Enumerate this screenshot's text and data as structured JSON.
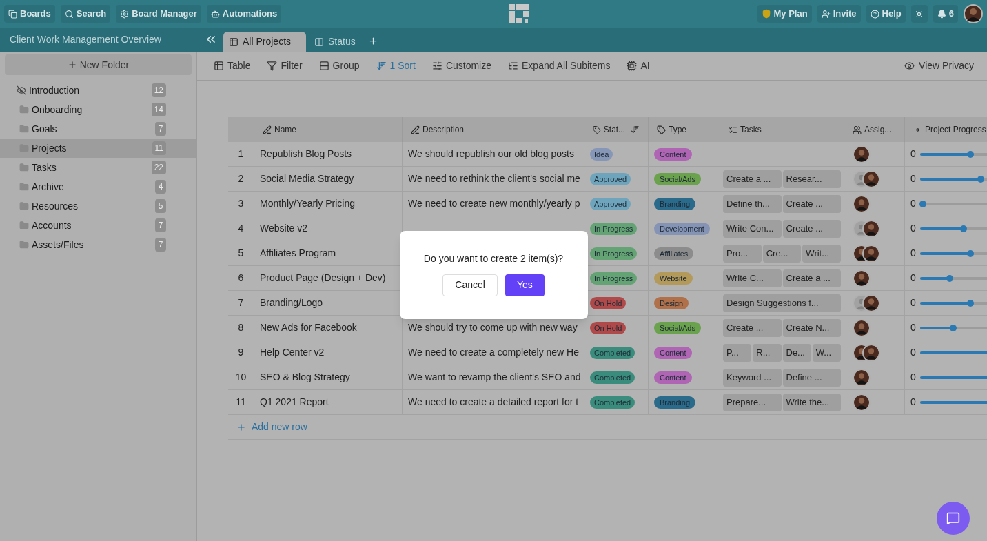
{
  "top_bar": {
    "left_buttons": [
      "Boards",
      "Search",
      "Board Manager",
      "Automations"
    ],
    "plan": "My Plan",
    "invite": "Invite",
    "help": "Help",
    "notifications": "6"
  },
  "workspace_title": "Client Work Management Overview",
  "tabs": [
    {
      "label": "All Projects",
      "kind": "table",
      "selected": true
    },
    {
      "label": "Status",
      "kind": "board",
      "selected": false
    }
  ],
  "toolbar": [
    {
      "label": "Table",
      "active": false
    },
    {
      "label": "Filter",
      "active": false
    },
    {
      "label": "Group",
      "active": false
    },
    {
      "label": "1 Sort",
      "active": true
    },
    {
      "label": "Customize",
      "active": false
    },
    {
      "label": "Expand All Subitems",
      "active": false
    },
    {
      "label": "AI",
      "active": false
    }
  ],
  "view_privacy": "View Privacy",
  "sidebar": {
    "new_folder": "New Folder",
    "items": [
      {
        "name": "Introduction",
        "count": "12",
        "kind": "hidden",
        "selected": false
      },
      {
        "name": "Onboarding",
        "count": "14",
        "kind": "folder",
        "selected": false
      },
      {
        "name": "Goals",
        "count": "7",
        "kind": "folder",
        "selected": false
      },
      {
        "name": "Projects",
        "count": "11",
        "kind": "folder",
        "selected": true
      },
      {
        "name": "Tasks",
        "count": "22",
        "kind": "folder",
        "selected": false
      },
      {
        "name": "Archive",
        "count": "4",
        "kind": "folder",
        "selected": false
      },
      {
        "name": "Resources",
        "count": "5",
        "kind": "folder",
        "selected": false
      },
      {
        "name": "Accounts",
        "count": "7",
        "kind": "folder",
        "selected": false
      },
      {
        "name": "Assets/Files",
        "count": "7",
        "kind": "folder",
        "selected": false
      }
    ]
  },
  "table": {
    "columns": [
      "Name",
      "Description",
      "Stat...",
      "Type",
      "Tasks",
      "Assig...",
      "Project Progress"
    ],
    "rows": [
      {
        "index": "1",
        "name": "Republish Blog Posts",
        "description": "We should republish our old blog posts",
        "status": {
          "label": "Idea",
          "color": "#8696b7"
        },
        "type": {
          "label": "Content",
          "color": "#b064b4"
        },
        "tasks": [],
        "assignees": [
          {
            "kind": "photo"
          }
        ],
        "progress": "0",
        "level": 0.58
      },
      {
        "index": "2",
        "name": "Social Media Strategy",
        "description": "We need to rethink the client's social me",
        "status": {
          "label": "Approved",
          "color": "#6ea5bc"
        },
        "type": {
          "label": "Social/Ads",
          "color": "#6ba24d"
        },
        "tasks": [
          "Create a ...",
          "Resear..."
        ],
        "assignees": [
          {
            "kind": "placeholder"
          },
          {
            "kind": "photo"
          }
        ],
        "progress": "0",
        "level": 0.7
      },
      {
        "index": "3",
        "name": "Monthly/Yearly Pricing",
        "description": "We need to create new monthly/yearly p",
        "status": {
          "label": "Approved",
          "color": "#6ea5bc"
        },
        "type": {
          "label": "Branding",
          "color": "#2a6a8a"
        },
        "tasks": [
          "Define th...",
          "Create ..."
        ],
        "assignees": [
          {
            "kind": "photo"
          }
        ],
        "progress": "0",
        "level": 0.03
      },
      {
        "index": "4",
        "name": "Website v2",
        "status": {
          "label": "In Progress",
          "color": "#63a374"
        },
        "type": {
          "label": "Development",
          "color": "#8593b5"
        },
        "tasks": [
          "Write Con...",
          "Create ..."
        ],
        "assignees": [
          {
            "kind": "placeholder"
          },
          {
            "kind": "photo"
          }
        ],
        "progress": "0",
        "level": 0.5
      },
      {
        "index": "5",
        "name": "Affiliates Program",
        "status": {
          "label": "In Progress",
          "color": "#63a374"
        },
        "type": {
          "label": "Affiliates",
          "color": "#8c8c8c"
        },
        "tasks": [
          "Pro...",
          "Cre...",
          "Writ..."
        ],
        "assignees": [
          {
            "kind": "photo"
          },
          {
            "kind": "photo"
          }
        ],
        "progress": "0",
        "level": 0.58
      },
      {
        "index": "6",
        "name": "Product Page (Design + Dev)",
        "status": {
          "label": "In Progress",
          "color": "#63a374"
        },
        "type": {
          "label": "Website",
          "color": "#b39a5a"
        },
        "tasks": [
          "Write C...",
          "Create a ..."
        ],
        "assignees": [
          {
            "kind": "photo"
          }
        ],
        "progress": "0",
        "level": 0.34
      },
      {
        "index": "7",
        "name": "Branding/Logo",
        "status": {
          "label": "On Hold",
          "color": "#b04a4a"
        },
        "type": {
          "label": "Design",
          "color": "#b0704a"
        },
        "tasks": [
          "Design Suggestions f..."
        ],
        "assignees": [
          {
            "kind": "placeholder"
          },
          {
            "kind": "photo"
          }
        ],
        "progress": "0",
        "level": 0.58
      },
      {
        "index": "8",
        "name": "New Ads for Facebook",
        "description": "We should try to come up with new way",
        "status": {
          "label": "On Hold",
          "color": "#b04a4a"
        },
        "type": {
          "label": "Social/Ads",
          "color": "#6ba24d"
        },
        "tasks": [
          "Create ...",
          "Create N..."
        ],
        "assignees": [
          {
            "kind": "photo"
          }
        ],
        "progress": "0",
        "level": 0.38
      },
      {
        "index": "9",
        "name": "Help Center v2",
        "description": "We need to create a completely new He",
        "status": {
          "label": "Completed",
          "color": "#3a8c7c"
        },
        "type": {
          "label": "Content",
          "color": "#b064b4"
        },
        "tasks": [
          "P...",
          "R...",
          "De...",
          "W..."
        ],
        "assignees": [
          {
            "kind": "photo"
          },
          {
            "kind": "photo"
          }
        ],
        "progress": "0",
        "level": 1
      },
      {
        "index": "10",
        "name": "SEO & Blog Strategy",
        "description": "We want to revamp the client's SEO and",
        "status": {
          "label": "Completed",
          "color": "#3a8c7c"
        },
        "type": {
          "label": "Content",
          "color": "#b064b4"
        },
        "tasks": [
          "Keyword ...",
          "Define ..."
        ],
        "assignees": [
          {
            "kind": "photo"
          }
        ],
        "progress": "0",
        "level": 1
      },
      {
        "index": "11",
        "name": "Q1 2021 Report",
        "description": "We need to create a detailed report for t",
        "status": {
          "label": "Completed",
          "color": "#3a8c7c"
        },
        "type": {
          "label": "Branding",
          "color": "#2a6a8a"
        },
        "tasks": [
          "Prepare...",
          "Write the..."
        ],
        "assignees": [
          {
            "kind": "photo"
          }
        ],
        "progress": "0",
        "level": 1
      }
    ],
    "add_row": "Add new row"
  },
  "dialog": {
    "message": "Do you want to create 2 item(s)?",
    "cancel": "Cancel",
    "confirm": "Yes"
  }
}
